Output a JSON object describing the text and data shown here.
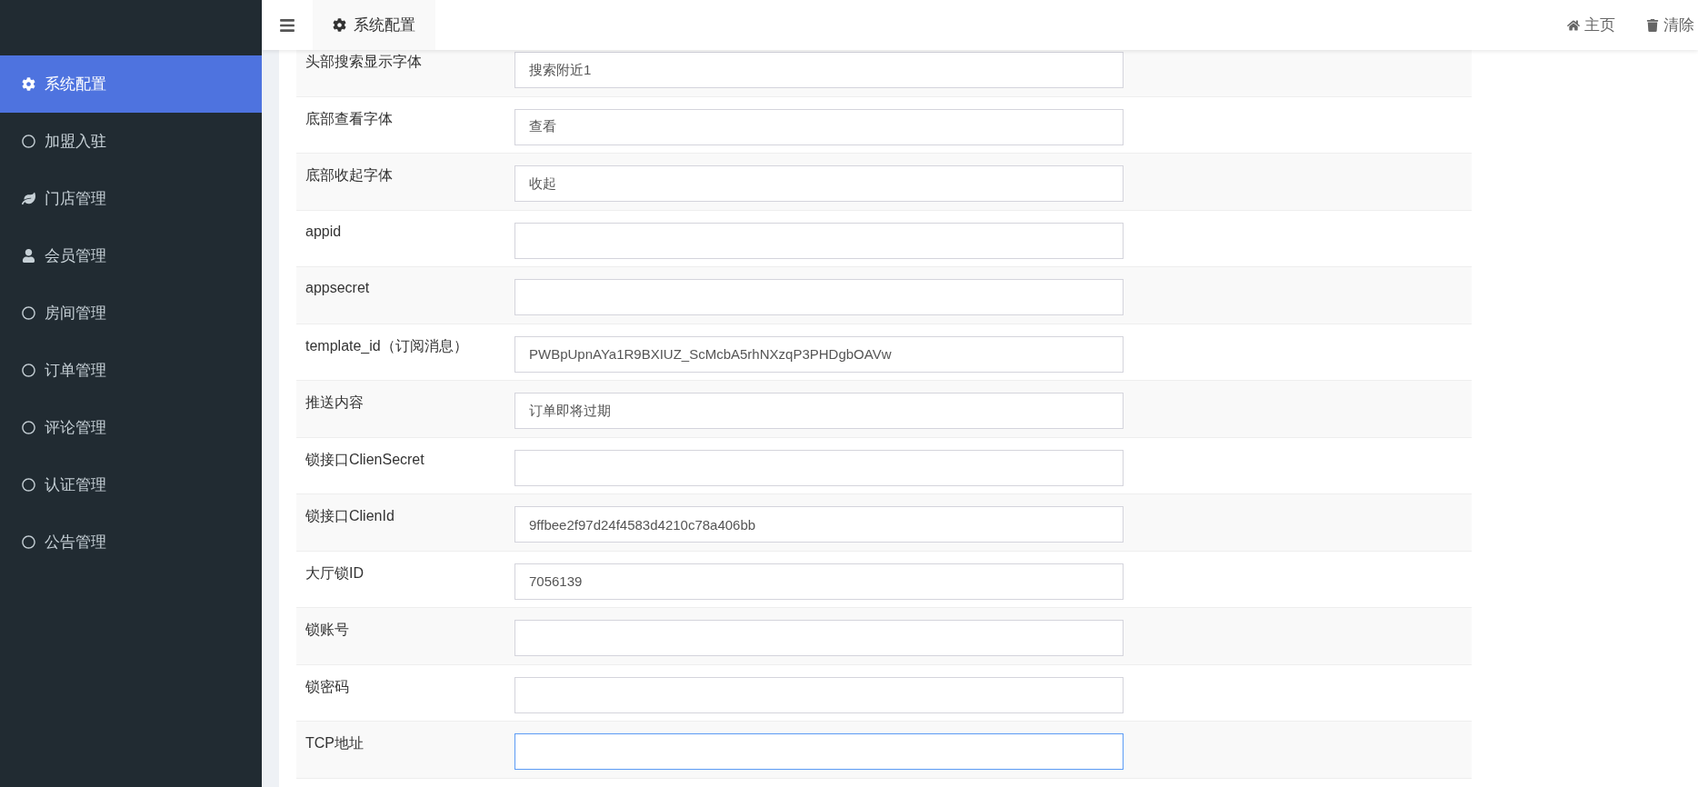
{
  "sidebar": {
    "items": [
      {
        "label": "系统配置",
        "kind": "gear",
        "selected": true
      },
      {
        "label": "加盟入驻",
        "kind": "circle",
        "selected": false
      },
      {
        "label": "门店管理",
        "kind": "leaf",
        "selected": false
      },
      {
        "label": "会员管理",
        "kind": "user",
        "selected": false
      },
      {
        "label": "房间管理",
        "kind": "circle",
        "selected": false
      },
      {
        "label": "订单管理",
        "kind": "circle",
        "selected": false
      },
      {
        "label": "评论管理",
        "kind": "circle",
        "selected": false
      },
      {
        "label": "认证管理",
        "kind": "circle",
        "selected": false
      },
      {
        "label": "公告管理",
        "kind": "circle",
        "selected": false
      }
    ]
  },
  "header": {
    "tab": {
      "label": "系统配置"
    },
    "links": [
      {
        "label": "主页"
      },
      {
        "label": "清除"
      }
    ]
  },
  "form": {
    "fields": [
      {
        "label": "头部搜索显示字体",
        "value": "搜索附近1",
        "focused": false
      },
      {
        "label": "底部查看字体",
        "value": "查看",
        "focused": false
      },
      {
        "label": "底部收起字体",
        "value": "收起",
        "focused": false
      },
      {
        "label": "appid",
        "focused": false
      },
      {
        "label": "appsecret",
        "focused": false
      },
      {
        "label": "template_id（订阅消息）",
        "value": "PWBpUpnAYa1R9BXIUZ_ScMcbA5rhNXzqP3PHDgbOAVw",
        "focused": false
      },
      {
        "label": "推送内容",
        "value": "订单即将过期",
        "focused": false
      },
      {
        "label": "锁接口ClienSecret",
        "focused": false
      },
      {
        "label": "锁接口ClienId",
        "value": "9ffbee2f97d24f4583d4210c78a406bb",
        "focused": false
      },
      {
        "label": "大厅锁ID",
        "value": "7056139",
        "focused": false
      },
      {
        "label": "锁账号",
        "focused": false
      },
      {
        "label": "锁密码",
        "focused": false
      },
      {
        "label": "TCP地址",
        "focused": true
      }
    ]
  }
}
